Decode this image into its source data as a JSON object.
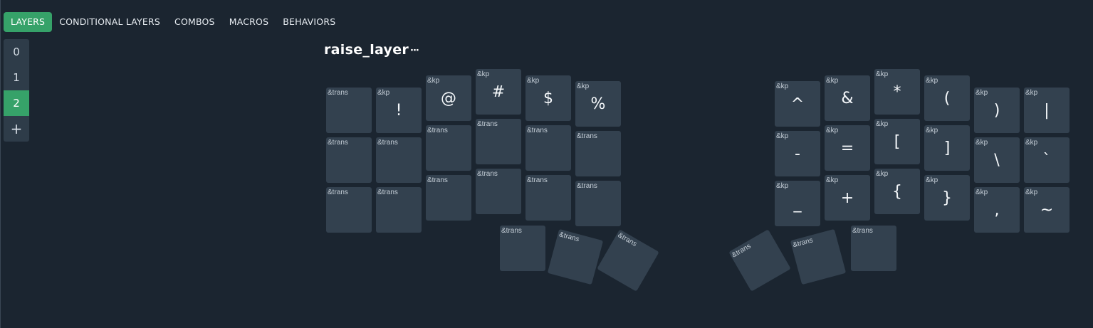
{
  "tabs": [
    {
      "label": "LAYERS",
      "active": true
    },
    {
      "label": "CONDITIONAL LAYERS",
      "active": false
    },
    {
      "label": "COMBOS",
      "active": false
    },
    {
      "label": "MACROS",
      "active": false
    },
    {
      "label": "BEHAVIORS",
      "active": false
    }
  ],
  "layers": [
    {
      "label": "0",
      "active": false
    },
    {
      "label": "1",
      "active": false
    },
    {
      "label": "2",
      "active": true
    }
  ],
  "add_layer_label": "+",
  "layer_title": "raise_layer",
  "more_label": "···",
  "colors": {
    "background": "#1b2530",
    "key": "#33414f",
    "accent": "#36a269"
  },
  "keys": [
    {
      "behavior": "&trans",
      "legend": ""
    },
    {
      "behavior": "&kp",
      "legend": "!"
    },
    {
      "behavior": "&kp",
      "legend": "@"
    },
    {
      "behavior": "&kp",
      "legend": "#"
    },
    {
      "behavior": "&kp",
      "legend": "$"
    },
    {
      "behavior": "&kp",
      "legend": "%"
    },
    {
      "behavior": "&kp",
      "legend": "^"
    },
    {
      "behavior": "&kp",
      "legend": "&"
    },
    {
      "behavior": "&kp",
      "legend": "*"
    },
    {
      "behavior": "&kp",
      "legend": "("
    },
    {
      "behavior": "&kp",
      "legend": ")"
    },
    {
      "behavior": "&kp",
      "legend": "|"
    },
    {
      "behavior": "&trans",
      "legend": ""
    },
    {
      "behavior": "&trans",
      "legend": ""
    },
    {
      "behavior": "&trans",
      "legend": ""
    },
    {
      "behavior": "&trans",
      "legend": ""
    },
    {
      "behavior": "&trans",
      "legend": ""
    },
    {
      "behavior": "&trans",
      "legend": ""
    },
    {
      "behavior": "&kp",
      "legend": "-"
    },
    {
      "behavior": "&kp",
      "legend": "="
    },
    {
      "behavior": "&kp",
      "legend": "["
    },
    {
      "behavior": "&kp",
      "legend": "]"
    },
    {
      "behavior": "&kp",
      "legend": "\\"
    },
    {
      "behavior": "&kp",
      "legend": "`"
    },
    {
      "behavior": "&trans",
      "legend": ""
    },
    {
      "behavior": "&trans",
      "legend": ""
    },
    {
      "behavior": "&trans",
      "legend": ""
    },
    {
      "behavior": "&trans",
      "legend": ""
    },
    {
      "behavior": "&trans",
      "legend": ""
    },
    {
      "behavior": "&trans",
      "legend": ""
    },
    {
      "behavior": "&kp",
      "legend": "_"
    },
    {
      "behavior": "&kp",
      "legend": "+"
    },
    {
      "behavior": "&kp",
      "legend": "{"
    },
    {
      "behavior": "&kp",
      "legend": "}"
    },
    {
      "behavior": "&kp",
      "legend": ","
    },
    {
      "behavior": "&kp",
      "legend": "~"
    },
    {
      "behavior": "&trans",
      "legend": ""
    },
    {
      "behavior": "&trans",
      "legend": ""
    },
    {
      "behavior": "&trans",
      "legend": ""
    },
    {
      "behavior": "&trans",
      "legend": ""
    },
    {
      "behavior": "&trans",
      "legend": ""
    },
    {
      "behavior": "&trans",
      "legend": ""
    }
  ]
}
